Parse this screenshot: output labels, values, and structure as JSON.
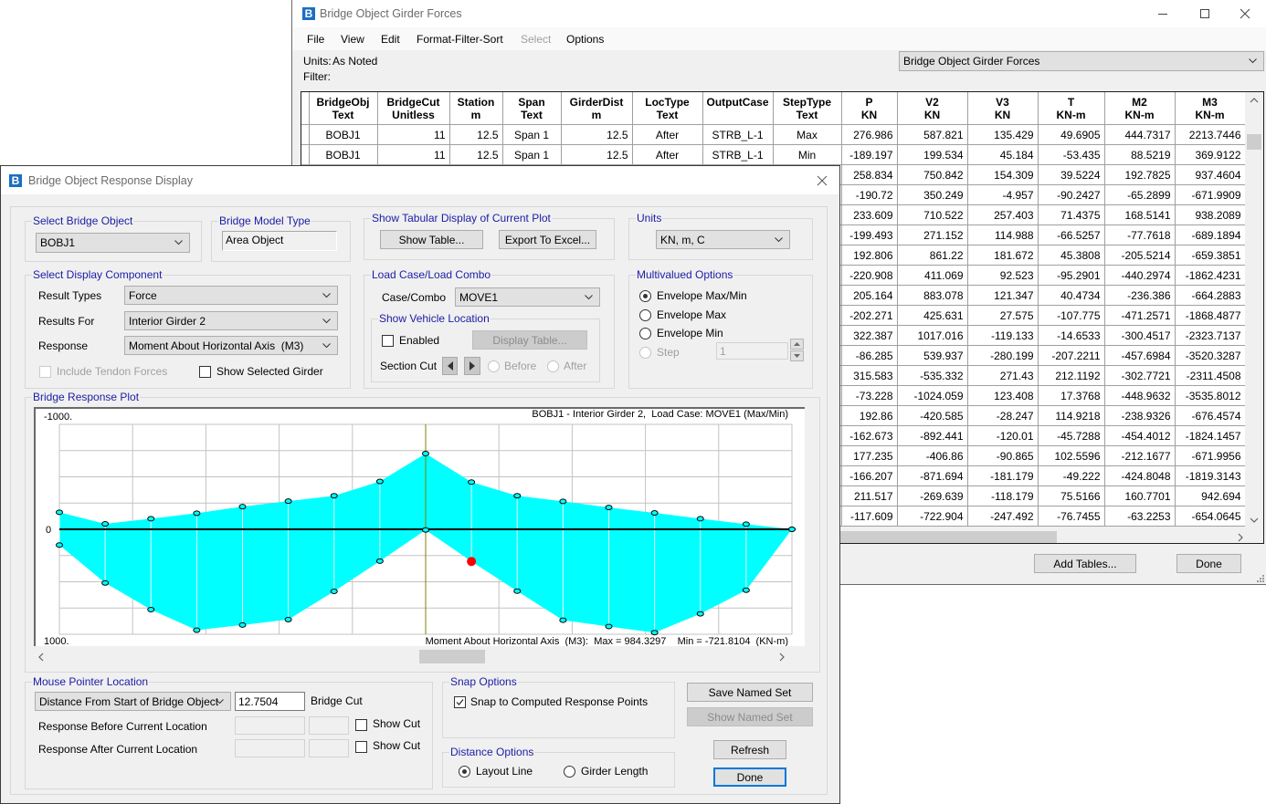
{
  "back_window": {
    "title": "Bridge Object Girder Forces",
    "icon_letter": "B",
    "menu": [
      {
        "label": "File",
        "enabled": true
      },
      {
        "label": "View",
        "enabled": true
      },
      {
        "label": "Edit",
        "enabled": true
      },
      {
        "label": "Format-Filter-Sort",
        "enabled": true
      },
      {
        "label": "Select",
        "enabled": false
      },
      {
        "label": "Options",
        "enabled": true
      }
    ],
    "units_label": "Units:",
    "units_value": "As Noted",
    "filter_label": "Filter:",
    "table_selector": "Bridge Object Girder Forces",
    "table": {
      "columns": [
        {
          "name": "BridgeObj",
          "unit": "Text"
        },
        {
          "name": "BridgeCut",
          "unit": "Unitless"
        },
        {
          "name": "Station",
          "unit": "m"
        },
        {
          "name": "Span",
          "unit": "Text"
        },
        {
          "name": "GirderDist",
          "unit": "m"
        },
        {
          "name": "LocType",
          "unit": "Text"
        },
        {
          "name": "OutputCase",
          "unit": ""
        },
        {
          "name": "StepType",
          "unit": "Text"
        },
        {
          "name": "P",
          "unit": "KN"
        },
        {
          "name": "V2",
          "unit": "KN"
        },
        {
          "name": "V3",
          "unit": "KN"
        },
        {
          "name": "T",
          "unit": "KN-m"
        },
        {
          "name": "M2",
          "unit": "KN-m"
        },
        {
          "name": "M3",
          "unit": "KN-m"
        }
      ],
      "rows": [
        [
          "BOBJ1",
          "11",
          "12.5",
          "Span 1",
          "12.5",
          "After",
          "STRB_L-1",
          "Max",
          "276.986",
          "587.821",
          "135.429",
          "49.6905",
          "444.7317",
          "2213.7446"
        ],
        [
          "BOBJ1",
          "11",
          "12.5",
          "Span 1",
          "12.5",
          "After",
          "STRB_L-1",
          "Min",
          "-189.197",
          "199.534",
          "45.184",
          "-53.435",
          "88.5219",
          "369.9122"
        ],
        [
          null,
          null,
          null,
          null,
          null,
          null,
          null,
          null,
          "258.834",
          "750.842",
          "154.309",
          "39.5224",
          "192.7825",
          "937.4604"
        ],
        [
          null,
          null,
          null,
          null,
          null,
          null,
          null,
          null,
          "-190.72",
          "350.249",
          "-4.957",
          "-90.2427",
          "-65.2899",
          "-671.9909"
        ],
        [
          null,
          null,
          null,
          null,
          null,
          null,
          null,
          null,
          "233.609",
          "710.522",
          "257.403",
          "71.4375",
          "168.5141",
          "938.2089"
        ],
        [
          null,
          null,
          null,
          null,
          null,
          null,
          null,
          null,
          "-199.493",
          "271.152",
          "114.988",
          "-66.5257",
          "-77.7618",
          "-689.1894"
        ],
        [
          null,
          null,
          null,
          null,
          null,
          null,
          null,
          null,
          "192.806",
          "861.22",
          "181.672",
          "45.3808",
          "-205.5214",
          "-659.3851"
        ],
        [
          null,
          null,
          null,
          null,
          null,
          null,
          null,
          null,
          "-220.908",
          "411.069",
          "92.523",
          "-95.2901",
          "-440.2974",
          "-1862.4231"
        ],
        [
          null,
          null,
          null,
          null,
          null,
          null,
          null,
          null,
          "205.164",
          "883.078",
          "121.347",
          "40.4734",
          "-236.386",
          "-664.2883"
        ],
        [
          null,
          null,
          null,
          null,
          null,
          null,
          null,
          null,
          "-202.271",
          "425.631",
          "27.575",
          "-107.775",
          "-471.2571",
          "-1868.4877"
        ],
        [
          null,
          null,
          null,
          null,
          null,
          null,
          null,
          null,
          "322.387",
          "1017.016",
          "-119.133",
          "-14.6533",
          "-300.4517",
          "-2323.7137"
        ],
        [
          null,
          null,
          null,
          null,
          null,
          null,
          null,
          null,
          "-86.285",
          "539.937",
          "-280.199",
          "-207.2211",
          "-457.6984",
          "-3520.3287"
        ],
        [
          null,
          null,
          null,
          null,
          null,
          null,
          null,
          null,
          "315.583",
          "-535.332",
          "271.43",
          "212.1192",
          "-302.7721",
          "-2311.4508"
        ],
        [
          null,
          null,
          null,
          null,
          null,
          null,
          null,
          null,
          "-73.228",
          "-1024.059",
          "123.408",
          "17.3768",
          "-448.9632",
          "-3535.8012"
        ],
        [
          null,
          null,
          null,
          null,
          null,
          null,
          null,
          null,
          "192.86",
          "-420.585",
          "-28.247",
          "114.9218",
          "-238.9326",
          "-676.4574"
        ],
        [
          null,
          null,
          null,
          null,
          null,
          null,
          null,
          null,
          "-162.673",
          "-892.441",
          "-120.01",
          "-45.7288",
          "-454.4012",
          "-1824.1457"
        ],
        [
          null,
          null,
          null,
          null,
          null,
          null,
          null,
          null,
          "177.235",
          "-406.86",
          "-90.865",
          "102.5596",
          "-212.1677",
          "-671.9956"
        ],
        [
          null,
          null,
          null,
          null,
          null,
          null,
          null,
          null,
          "-166.207",
          "-871.694",
          "-181.179",
          "-49.222",
          "-424.8048",
          "-1819.3143"
        ],
        [
          null,
          null,
          null,
          null,
          null,
          null,
          null,
          null,
          "211.517",
          "-269.639",
          "-118.179",
          "75.5166",
          "160.7701",
          "942.694"
        ],
        [
          null,
          null,
          null,
          null,
          null,
          null,
          null,
          null,
          "-117.609",
          "-722.904",
          "-247.492",
          "-76.7455",
          "-63.2253",
          "-654.0645"
        ]
      ]
    },
    "buttons": {
      "add_tables": "Add Tables...",
      "done": "Done"
    }
  },
  "dialog": {
    "title": "Bridge Object Response Display",
    "icon_letter": "B",
    "select_bridge_object": {
      "label": "Select Bridge Object",
      "value": "BOBJ1"
    },
    "bridge_model_type": {
      "label": "Bridge Model Type",
      "value": "Area Object"
    },
    "tabular_display": {
      "label": "Show Tabular Display of Current Plot",
      "show_table": "Show Table...",
      "export_excel": "Export To Excel..."
    },
    "units": {
      "label": "Units",
      "value": "KN, m, C"
    },
    "display_component": {
      "label": "Select Display Component",
      "result_types_label": "Result Types",
      "result_types": "Force",
      "results_for_label": "Results For",
      "results_for": "Interior Girder 2",
      "response_label": "Response",
      "response": "Moment About Horizontal Axis  (M3)",
      "include_tendon_label": "Include Tendon Forces",
      "include_tendon_checked": false,
      "include_tendon_enabled": false,
      "show_selected_girder_label": "Show Selected Girder",
      "show_selected_girder_checked": false
    },
    "load_case": {
      "label": "Load Case/Load Combo",
      "case_label": "Case/Combo",
      "case_value": "MOVE1",
      "vehicle": {
        "label": "Show Vehicle Location",
        "enabled_label": "Enabled",
        "enabled_checked": false,
        "display_table": "Display Table...",
        "section_cut_label": "Section Cut",
        "before_label": "Before",
        "after_label": "After"
      }
    },
    "multivalued": {
      "label": "Multivalued Options",
      "options": [
        {
          "label": "Envelope Max/Min",
          "selected": true,
          "enabled": true
        },
        {
          "label": "Envelope Max",
          "selected": false,
          "enabled": true
        },
        {
          "label": "Envelope Min",
          "selected": false,
          "enabled": true
        },
        {
          "label": "Step",
          "selected": false,
          "enabled": false
        }
      ],
      "step_value": "1"
    },
    "plot": {
      "label": "Bridge Response Plot"
    },
    "mouse_pointer": {
      "label": "Mouse Pointer Location",
      "mode": "Distance From Start of Bridge Object",
      "distance": "12.7504",
      "cut_label": "Bridge Cut",
      "before_label": "Response Before Current Location",
      "after_label": "Response After Current Location",
      "show_cut_label": "Show Cut"
    },
    "snap": {
      "label": "Snap Options",
      "snap_label": "Snap to Computed Response Points",
      "checked": true
    },
    "distance_options": {
      "label": "Distance Options",
      "options": [
        {
          "label": "Layout Line",
          "selected": true
        },
        {
          "label": "Girder Length",
          "selected": false
        }
      ]
    },
    "buttons": {
      "save_named_set": "Save Named Set",
      "show_named_set": "Show Named Set",
      "refresh": "Refresh",
      "done": "Done"
    }
  },
  "chart_data": {
    "type": "area",
    "title": "BOBJ1 - Interior Girder 2,  Load Case: MOVE1 (Max/Min)",
    "footer": "Moment About Horizontal Axis  (M3):  Max = 984.3297    Min = -721.8104  (KN-m)",
    "xlabel": "",
    "ylabel": "",
    "x_description": "response point index along bridge object",
    "x": [
      0,
      1,
      2,
      3,
      4,
      5,
      6,
      7,
      8,
      9,
      10,
      11,
      12,
      13,
      14,
      15,
      16
    ],
    "ylim": [
      -1000,
      1000
    ],
    "y_inverted": true,
    "y_tick_labels": {
      "top": "-1000.",
      "zero": "0",
      "bottom": "1000."
    },
    "series": [
      {
        "name": "Envelope Min",
        "values": [
          -162,
          -52,
          -101,
          -153,
          -216,
          -268,
          -320,
          -456,
          -721.8104,
          -450,
          -320,
          -266,
          -208,
          -156,
          -101,
          -49,
          0
        ]
      },
      {
        "name": "Envelope Max",
        "values": [
          150,
          511,
          765,
          961,
          912,
          860,
          591,
          303,
          6,
          306,
          589,
          866,
          926,
          984.3297,
          805,
          580,
          0
        ]
      }
    ],
    "max": 984.3297,
    "min": -721.8104,
    "units": "KN-m",
    "support_index": 8,
    "current_location": {
      "index": 9,
      "value": 306
    },
    "grid": true,
    "colors": {
      "fill": "#00ffff",
      "support_line": "#808000",
      "marker": "#ff0000",
      "zero_line": "#000000"
    }
  }
}
